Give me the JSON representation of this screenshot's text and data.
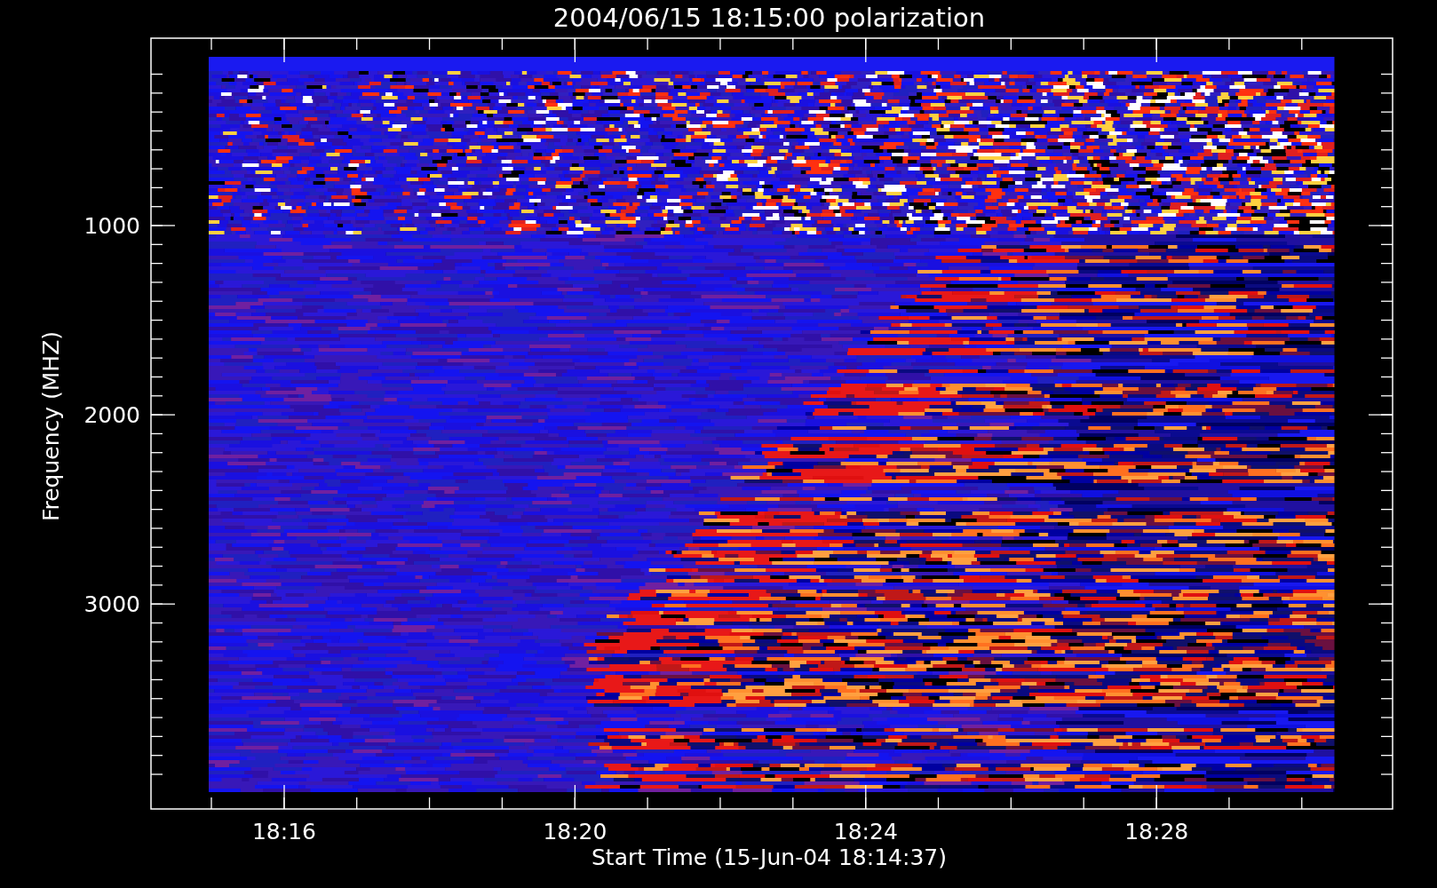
{
  "title": "2004/06/15 18:15:00 polarization",
  "xlabel": "Start Time (15-Jun-04 18:14:37)",
  "ylabel": "Frequency (MHZ)",
  "yticks": [
    "1000",
    "2000",
    "3000"
  ],
  "xticks": [
    "18:16",
    "18:20",
    "18:24",
    "18:28"
  ]
}
